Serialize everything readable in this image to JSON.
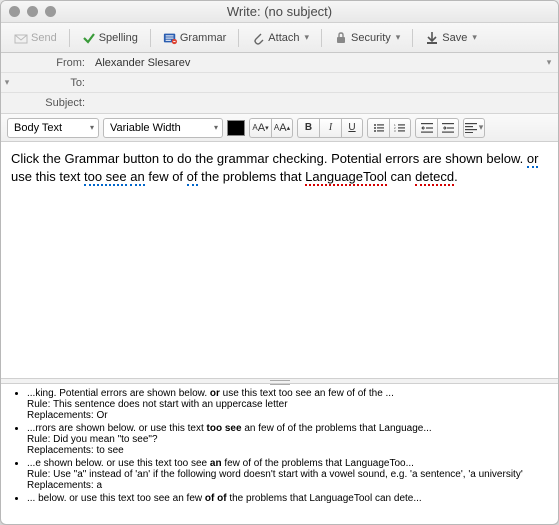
{
  "window": {
    "title": "Write: (no subject)"
  },
  "toolbar": {
    "send": "Send",
    "spelling": "Spelling",
    "grammar": "Grammar",
    "attach": "Attach",
    "security": "Security",
    "save": "Save"
  },
  "headers": {
    "from_label": "From:",
    "from_value": "Alexander Slesarev",
    "to_label": "To:",
    "to_value": "",
    "subject_label": "Subject:",
    "subject_value": ""
  },
  "format": {
    "paragraph": "Body Text",
    "font": "Variable Width",
    "dec": "A",
    "inc": "A",
    "bold": "B",
    "italic": "I",
    "underline": "U"
  },
  "body": {
    "t1": "Click the Grammar button to do the grammar checking. Potential errors are shown below. ",
    "t2": "or",
    "t3": " use this text ",
    "t4": "too see",
    "t5": " ",
    "t6": "an",
    "t7": " few of ",
    "t8": "of",
    "t9": " the problems that ",
    "t10": "LanguageTool",
    "t11": " can ",
    "t12": "detecd",
    "t13": "."
  },
  "issues": [
    {
      "line1a": "...king. Potential errors are shown below. ",
      "line1b": "or",
      "line1c": " use this text too see an few of of the ...",
      "rule": "Rule: This sentence does not start with an uppercase letter",
      "repl": "Replacements: Or"
    },
    {
      "line1a": "...rrors are shown below. or use this text ",
      "line1b": "too see",
      "line1c": " an few of of the problems that Language...",
      "rule": "Rule: Did you mean \"to see\"?",
      "repl": "Replacements: to see"
    },
    {
      "line1a": "...e shown below. or use this text too see ",
      "line1b": "an",
      "line1c": " few of of the problems that LanguageToo...",
      "rule": "Rule: Use \"a\" instead of 'an' if the following word doesn't start with a vowel sound, e.g. 'a sentence', 'a university'",
      "repl": "Replacements: a"
    },
    {
      "line1a": "... below. or use this text too see an few ",
      "line1b": "of of",
      "line1c": " the problems that LanguageTool can dete...",
      "rule": "",
      "repl": ""
    }
  ]
}
